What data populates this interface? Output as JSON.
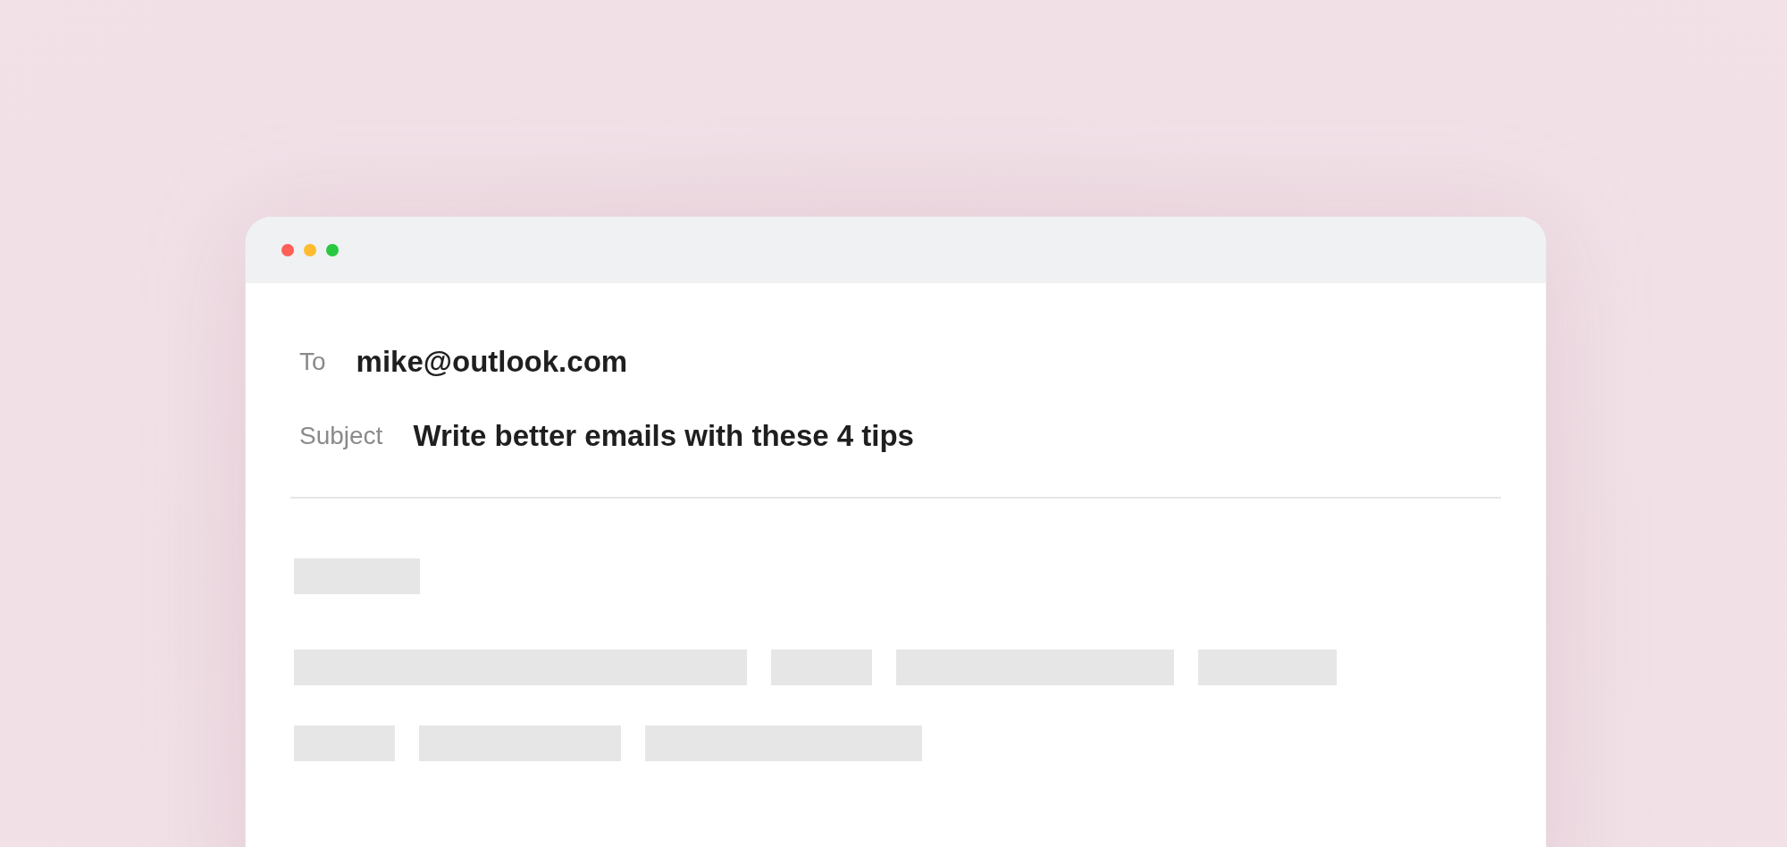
{
  "window": {
    "controls": [
      {
        "color": "#fe5f57"
      },
      {
        "color": "#febc2e"
      },
      {
        "color": "#28c840"
      }
    ]
  },
  "compose": {
    "fields": [
      {
        "label": "To",
        "value": "mike@outlook.com"
      },
      {
        "label": "Subject",
        "value": "Write better emails with these 4 tips"
      }
    ]
  }
}
